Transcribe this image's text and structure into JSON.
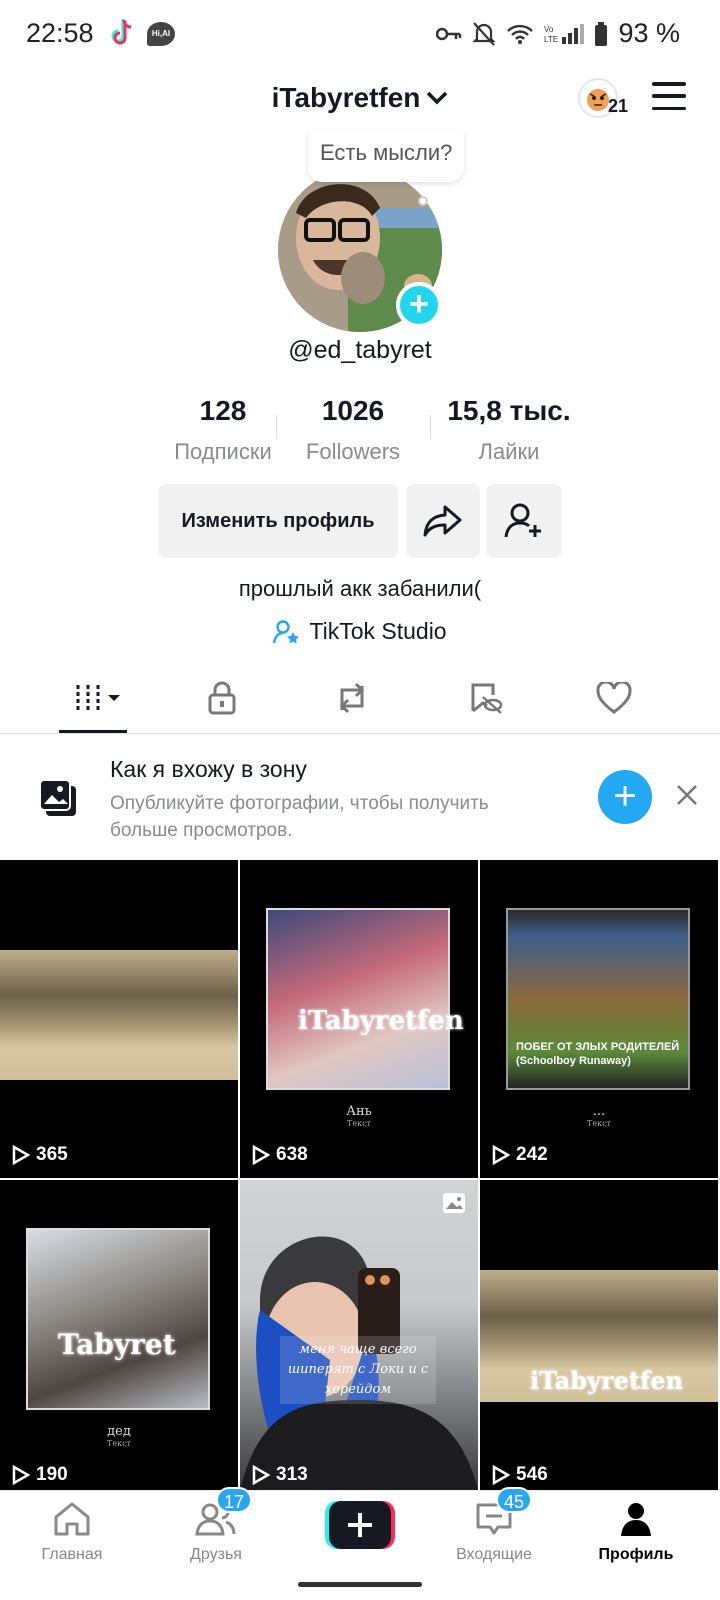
{
  "status_bar": {
    "time": "22:58",
    "battery": "93 %"
  },
  "header": {
    "username": "iTabyretfen",
    "notification_count": "21"
  },
  "profile": {
    "bubble_text": "Есть мысли?",
    "handle": "@ed_tabyret",
    "stats": [
      {
        "value": "128",
        "label": "Подписки"
      },
      {
        "value": "1026",
        "label": "Followers"
      },
      {
        "value": "15,8 тыс.",
        "label": "Лайки"
      }
    ],
    "edit_button": "Изменить профиль",
    "bio": "прошлый акк забанили(",
    "studio_link": "TikTok Studio"
  },
  "promo": {
    "title": "Как я вхожу в зону",
    "subtitle": "Опубликуйте фотографии, чтобы получить больше просмотров."
  },
  "videos": [
    {
      "views": "365"
    },
    {
      "views": "638",
      "caption": "Ань",
      "caption_sub": "Текст",
      "overlay": "iTabyretfen"
    },
    {
      "views": "242",
      "caption": "...",
      "caption_sub": "Текст",
      "overlay": "ПОБЕГ ОТ ЗЛЫХ РОДИТЕЛЕЙ (Schoolboy Runaway)"
    },
    {
      "views": "190",
      "caption": "дед",
      "caption_sub": "Текст",
      "overlay": "Tabyret"
    },
    {
      "views": "313",
      "overlay": "меня чаще всего шиперят с Локи и с херейдом"
    },
    {
      "views": "546",
      "overlay": "iTabyretfen"
    }
  ],
  "bottom_nav": {
    "home": "Главная",
    "friends": "Друзья",
    "friends_badge": "17",
    "inbox": "Входящие",
    "inbox_badge": "45",
    "profile": "Профиль"
  }
}
